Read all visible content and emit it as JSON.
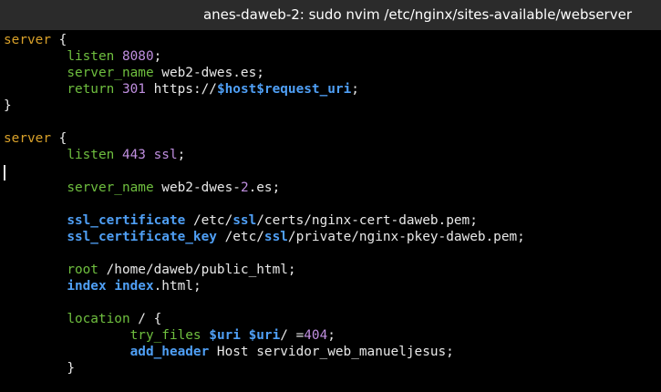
{
  "window": {
    "title": "anes-daweb-2: sudo nvim /etc/nginx/sites-available/webserver"
  },
  "editor": {
    "lines": [
      {
        "indent": "",
        "tokens": [
          {
            "c": "srv",
            "t": "server"
          },
          {
            "c": "pl",
            "t": " {"
          }
        ]
      },
      {
        "indent": "        ",
        "tokens": [
          {
            "c": "kw",
            "t": "listen"
          },
          {
            "c": "pl",
            "t": " "
          },
          {
            "c": "num",
            "t": "8080"
          },
          {
            "c": "pl",
            "t": ";"
          }
        ]
      },
      {
        "indent": "        ",
        "tokens": [
          {
            "c": "kw",
            "t": "server_name"
          },
          {
            "c": "pl",
            "t": " web2-dwes.es;"
          }
        ]
      },
      {
        "indent": "        ",
        "tokens": [
          {
            "c": "kw",
            "t": "return"
          },
          {
            "c": "pl",
            "t": " "
          },
          {
            "c": "num",
            "t": "301"
          },
          {
            "c": "pl",
            "t": " https://"
          },
          {
            "c": "var",
            "t": "$host$request_uri"
          },
          {
            "c": "pl",
            "t": ";"
          }
        ]
      },
      {
        "indent": "",
        "tokens": [
          {
            "c": "pl",
            "t": "}"
          }
        ]
      },
      {
        "indent": "",
        "tokens": []
      },
      {
        "indent": "",
        "tokens": [
          {
            "c": "srv",
            "t": "server"
          },
          {
            "c": "pl",
            "t": " {"
          }
        ]
      },
      {
        "indent": "        ",
        "tokens": [
          {
            "c": "kw",
            "t": "listen"
          },
          {
            "c": "pl",
            "t": " "
          },
          {
            "c": "num",
            "t": "443"
          },
          {
            "c": "pl",
            "t": " "
          },
          {
            "c": "mg",
            "t": "ssl"
          },
          {
            "c": "pl",
            "t": ";"
          }
        ]
      },
      {
        "indent": "",
        "tokens": []
      },
      {
        "indent": "        ",
        "tokens": [
          {
            "c": "kw",
            "t": "server_name"
          },
          {
            "c": "pl",
            "t": " web2-dwes-"
          },
          {
            "c": "num",
            "t": "2"
          },
          {
            "c": "pl",
            "t": ".es;"
          }
        ]
      },
      {
        "indent": "",
        "tokens": []
      },
      {
        "indent": "        ",
        "tokens": [
          {
            "c": "kwb",
            "t": "ssl_certificate"
          },
          {
            "c": "pl",
            "t": " /etc/"
          },
          {
            "c": "kwb",
            "t": "ssl"
          },
          {
            "c": "pl",
            "t": "/certs/nginx-cert-daweb.pem;"
          }
        ]
      },
      {
        "indent": "        ",
        "tokens": [
          {
            "c": "kwb",
            "t": "ssl_certificate_key"
          },
          {
            "c": "pl",
            "t": " /etc/"
          },
          {
            "c": "kwb",
            "t": "ssl"
          },
          {
            "c": "pl",
            "t": "/private/nginx-pkey-daweb.pem;"
          }
        ]
      },
      {
        "indent": "",
        "tokens": []
      },
      {
        "indent": "        ",
        "tokens": [
          {
            "c": "kw",
            "t": "root"
          },
          {
            "c": "pl",
            "t": " /home/daweb/public_html;"
          }
        ]
      },
      {
        "indent": "        ",
        "tokens": [
          {
            "c": "kwb",
            "t": "index"
          },
          {
            "c": "pl",
            "t": " "
          },
          {
            "c": "kwb",
            "t": "index"
          },
          {
            "c": "pl",
            "t": ".html;"
          }
        ]
      },
      {
        "indent": "",
        "tokens": []
      },
      {
        "indent": "        ",
        "tokens": [
          {
            "c": "kw",
            "t": "location"
          },
          {
            "c": "pl",
            "t": " / {"
          }
        ]
      },
      {
        "indent": "                ",
        "tokens": [
          {
            "c": "kw",
            "t": "try_files"
          },
          {
            "c": "pl",
            "t": " "
          },
          {
            "c": "var",
            "t": "$uri"
          },
          {
            "c": "pl",
            "t": " "
          },
          {
            "c": "var",
            "t": "$uri"
          },
          {
            "c": "pl",
            "t": "/ ="
          },
          {
            "c": "num",
            "t": "404"
          },
          {
            "c": "pl",
            "t": ";"
          }
        ]
      },
      {
        "indent": "                ",
        "tokens": [
          {
            "c": "kwb",
            "t": "add_header"
          },
          {
            "c": "pl",
            "t": " Host servidor_web_manueljesus;"
          }
        ]
      },
      {
        "indent": "        ",
        "tokens": [
          {
            "c": "pl",
            "t": "}"
          }
        ]
      }
    ]
  },
  "colors": {
    "background": "#000000",
    "titlebar": "#2b2b2b",
    "directive_green": "#6fbf3f",
    "keyword_blue": "#4f9ff5",
    "number_magenta": "#c08fe0",
    "server_orange": "#d9a12a"
  }
}
